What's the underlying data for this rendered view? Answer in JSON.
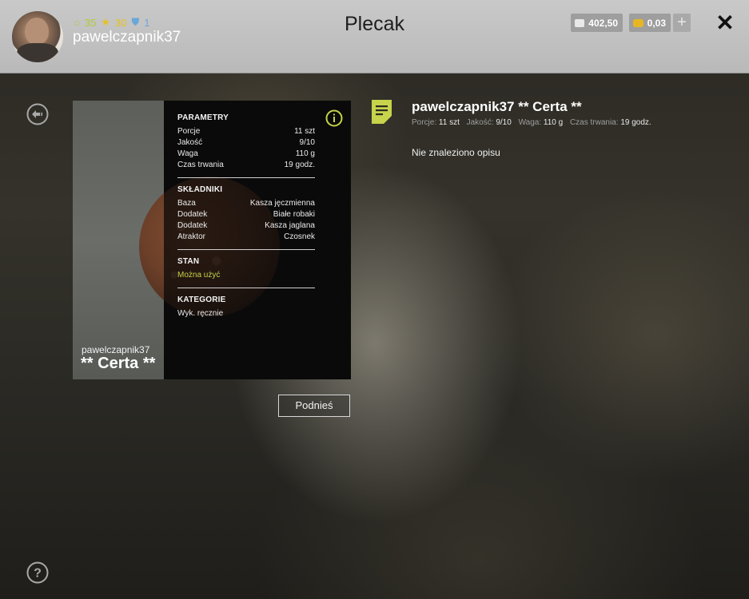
{
  "header": {
    "title": "Plecak",
    "user": {
      "name": "pawelczapnik37",
      "level": "35",
      "stars": "30",
      "shield": "1"
    },
    "currency": {
      "silver": "402,50",
      "gold": "0,03"
    },
    "add_label": "+"
  },
  "card": {
    "owner": "pawelczapnik37",
    "name": "** Certa **",
    "sections": {
      "params_title": "PARAMETRY",
      "params": [
        {
          "label": "Porcje",
          "value": "11 szt"
        },
        {
          "label": "Jakość",
          "value": "9/10"
        },
        {
          "label": "Waga",
          "value": "110 g"
        },
        {
          "label": "Czas trwania",
          "value": "19 godz."
        }
      ],
      "ingredients_title": "SKŁADNIKI",
      "ingredients": [
        {
          "label": "Baza",
          "value": "Kasza jęczmienna"
        },
        {
          "label": "Dodatek",
          "value": "Białe robaki"
        },
        {
          "label": "Dodatek",
          "value": "Kasza jaglana"
        },
        {
          "label": "Atraktor",
          "value": "Czosnek"
        }
      ],
      "state_title": "STAN",
      "state_value": "Można użyć",
      "category_title": "KATEGORIE",
      "category_value": "Wyk. ręcznie"
    }
  },
  "detail": {
    "title": "pawelczapnik37 ** Certa **",
    "meta": [
      {
        "label": "Porcje:",
        "value": "11 szt"
      },
      {
        "label": "Jakość:",
        "value": "9/10"
      },
      {
        "label": "Waga:",
        "value": "110 g"
      },
      {
        "label": "Czas trwania:",
        "value": "19 godz."
      }
    ],
    "description": "Nie znaleziono opisu"
  },
  "actions": {
    "pickup_label": "Podnieś"
  },
  "colors": {
    "accent": "#c7d34a",
    "header_bg": "#c2c2c2"
  },
  "icons": {
    "back": "back-arrow-icon",
    "help": "help-icon",
    "info": "info-icon",
    "note": "note-icon",
    "close": "close-icon"
  }
}
